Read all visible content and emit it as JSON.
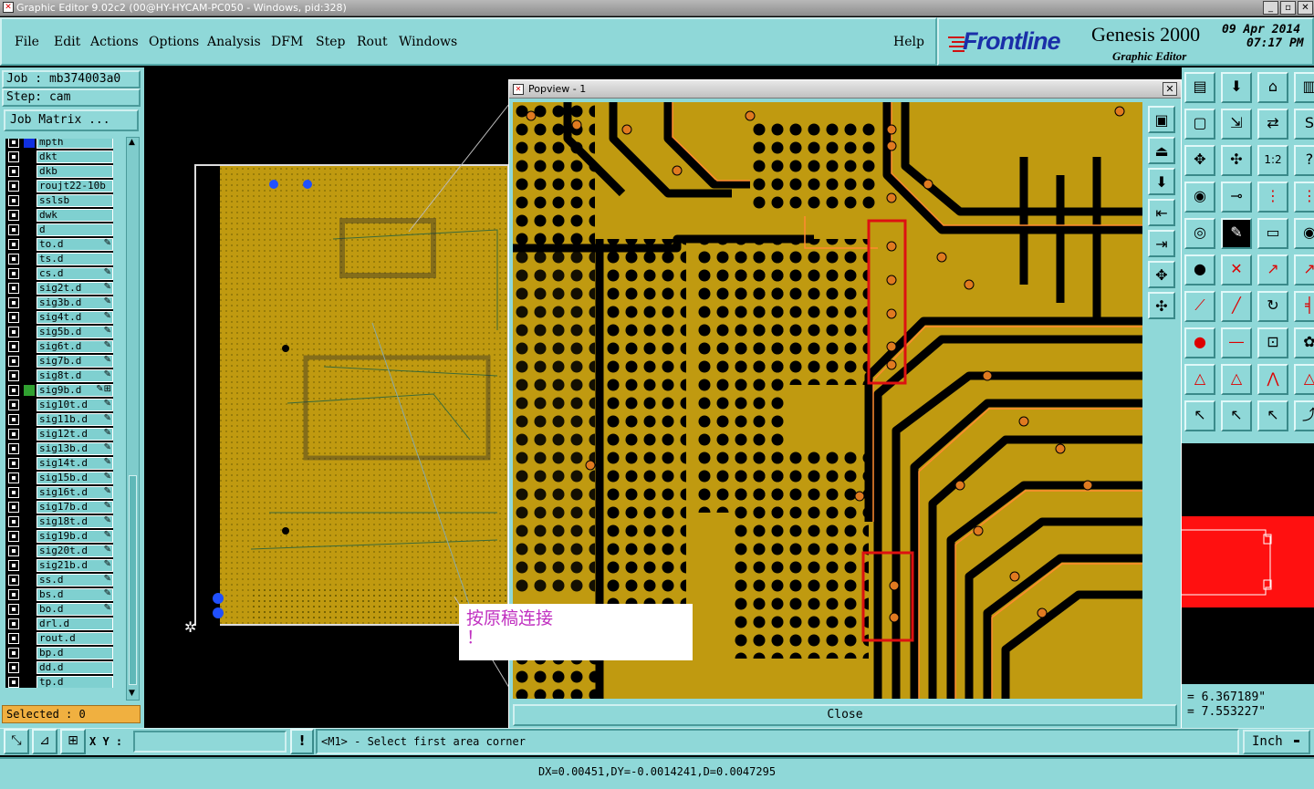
{
  "window": {
    "title": "Graphic Editor 9.02c2 (00@HY-HYCAM-PC050 - Windows, pid:328)",
    "buttons": [
      "_",
      "▫",
      "✕"
    ]
  },
  "menu": [
    "File",
    "Edit",
    "Actions",
    "Options",
    "Analysis",
    "DFM",
    "Step",
    "Rout",
    "Windows"
  ],
  "help_label": "Help",
  "logo": {
    "brand": "Frontline",
    "product": "Genesis 2000",
    "subtitle": "Graphic Editor",
    "date": "09 Apr 2014",
    "time": "07:17 PM"
  },
  "job": {
    "job_label": "Job : mb374003a0",
    "step_label": "Step: cam",
    "matrix_button": "Job Matrix ..."
  },
  "layers": [
    {
      "name": "mpth",
      "icon": ""
    },
    {
      "name": "dkt",
      "icon": ""
    },
    {
      "name": "dkb",
      "icon": ""
    },
    {
      "name": "roujt22-10b",
      "icon": ""
    },
    {
      "name": "sslsb",
      "icon": ""
    },
    {
      "name": "dwk",
      "icon": ""
    },
    {
      "name": "d",
      "icon": ""
    },
    {
      "name": "to.d",
      "icon": "✎"
    },
    {
      "name": "ts.d",
      "icon": ""
    },
    {
      "name": "cs.d",
      "icon": "✎"
    },
    {
      "name": "sig2t.d",
      "icon": "✎"
    },
    {
      "name": "sig3b.d",
      "icon": "✎"
    },
    {
      "name": "sig4t.d",
      "icon": "✎"
    },
    {
      "name": "sig5b.d",
      "icon": "✎"
    },
    {
      "name": "sig6t.d",
      "icon": "✎"
    },
    {
      "name": "sig7b.d",
      "icon": "✎"
    },
    {
      "name": "sig8t.d",
      "icon": "✎"
    },
    {
      "name": "sig9b.d",
      "icon": "✎⊞"
    },
    {
      "name": "sig10t.d",
      "icon": "✎"
    },
    {
      "name": "sig11b.d",
      "icon": "✎"
    },
    {
      "name": "sig12t.d",
      "icon": "✎"
    },
    {
      "name": "sig13b.d",
      "icon": "✎"
    },
    {
      "name": "sig14t.d",
      "icon": "✎"
    },
    {
      "name": "sig15b.d",
      "icon": "✎"
    },
    {
      "name": "sig16t.d",
      "icon": "✎"
    },
    {
      "name": "sig17b.d",
      "icon": "✎"
    },
    {
      "name": "sig18t.d",
      "icon": "✎"
    },
    {
      "name": "sig19b.d",
      "icon": "✎"
    },
    {
      "name": "sig20t.d",
      "icon": "✎"
    },
    {
      "name": "sig21b.d",
      "icon": "✎"
    },
    {
      "name": "ss.d",
      "icon": "✎"
    },
    {
      "name": "bs.d",
      "icon": "✎"
    },
    {
      "name": "bo.d",
      "icon": "✎"
    },
    {
      "name": "drl.d",
      "icon": ""
    },
    {
      "name": "rout.d",
      "icon": ""
    },
    {
      "name": "bp.d",
      "icon": ""
    },
    {
      "name": "dd.d",
      "icon": ""
    },
    {
      "name": "tp.d",
      "icon": ""
    }
  ],
  "selected_label": "Selected : 0",
  "popview": {
    "title": "Popview - 1",
    "close_label": "Close"
  },
  "note_text": "按原稿连接\n！",
  "coords": {
    "x": "= 6.367189\"",
    "y": "= 7.553227\""
  },
  "bottom": {
    "xy_label": "X Y :",
    "xy_value": "",
    "prompt": "<M1> - Select first area corner",
    "unit": "Inch"
  },
  "status": "DX=0.00451,DY=-0.0014241,D=0.0047295",
  "tool_icons": [
    "layer-icon",
    "down-icon",
    "home-icon",
    "window-icon",
    "frame-icon",
    "snap-icon",
    "mirror-icon",
    "s-icon",
    "zoom-icon",
    "center-icon",
    "ratio-icon",
    "help-icon",
    "eye-icon",
    "measure-icon",
    "route-icon",
    "route2-icon",
    "pick-icon",
    "pen-icon",
    "ruler-icon",
    "dot-icon",
    "net-icon",
    "cross-icon",
    "link-icon",
    "link2-icon",
    "line-icon",
    "slash-icon",
    "arc-icon",
    "f-icon",
    "pad-icon",
    "wire-icon",
    "box-icon",
    "cluster-icon",
    "tri-icon",
    "tri2-icon",
    "tri3-icon",
    "tri4-icon",
    "cursor-icon",
    "cursor2-icon",
    "cursor3-icon",
    "graph-icon"
  ],
  "colors": {
    "panel": "#8fd8d8",
    "copper": "#c09a10",
    "trace": "#ff8a30",
    "highlight": "#dd1111"
  }
}
